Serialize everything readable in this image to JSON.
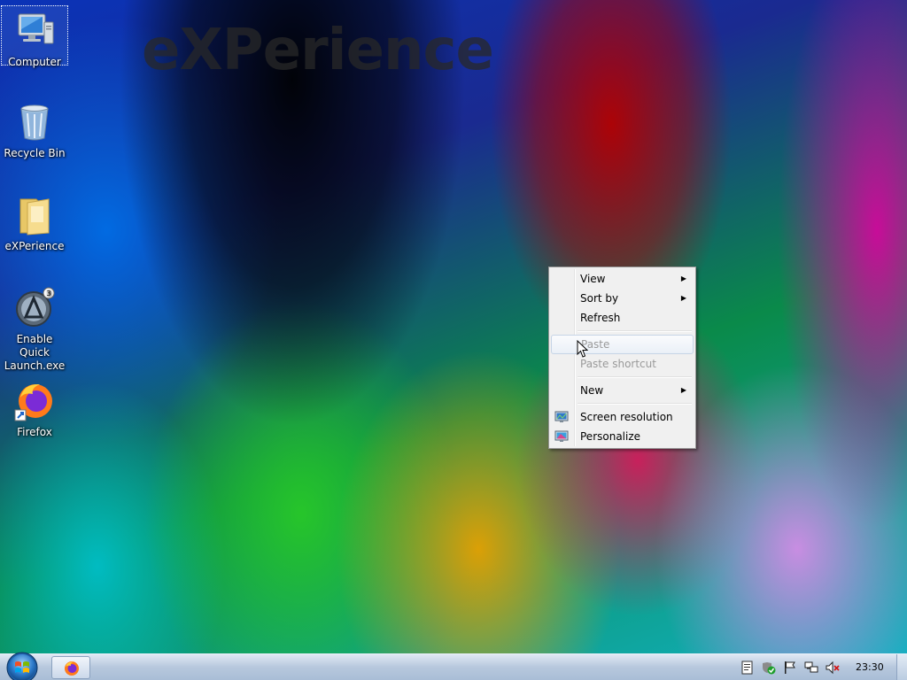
{
  "desktop": {
    "watermark": "eXPerience",
    "icons": [
      {
        "label": "Computer"
      },
      {
        "label": "Recycle Bin"
      },
      {
        "label": "eXPerience"
      },
      {
        "label": "Enable Quick Launch.exe"
      },
      {
        "label": "Firefox"
      }
    ]
  },
  "context_menu": {
    "items": [
      {
        "label": "View",
        "submenu": true,
        "enabled": true
      },
      {
        "label": "Sort by",
        "submenu": true,
        "enabled": true
      },
      {
        "label": "Refresh",
        "submenu": false,
        "enabled": true
      },
      {
        "label": "Paste",
        "submenu": false,
        "enabled": false
      },
      {
        "label": "Paste shortcut",
        "submenu": false,
        "enabled": false
      },
      {
        "label": "New",
        "submenu": true,
        "enabled": true
      },
      {
        "label": "Screen resolution",
        "submenu": false,
        "enabled": true,
        "icon": "screen-resolution-icon"
      },
      {
        "label": "Personalize",
        "submenu": false,
        "enabled": true,
        "icon": "personalize-icon"
      }
    ]
  },
  "taskbar": {
    "start_icon": "windows-orb-icon",
    "pinned": [
      {
        "icon": "firefox-icon"
      }
    ],
    "tray_icons": [
      "document-icon",
      "security-shield-icon",
      "action-center-flag-icon",
      "network-icon",
      "volume-muted-icon"
    ],
    "clock": "23:30"
  }
}
